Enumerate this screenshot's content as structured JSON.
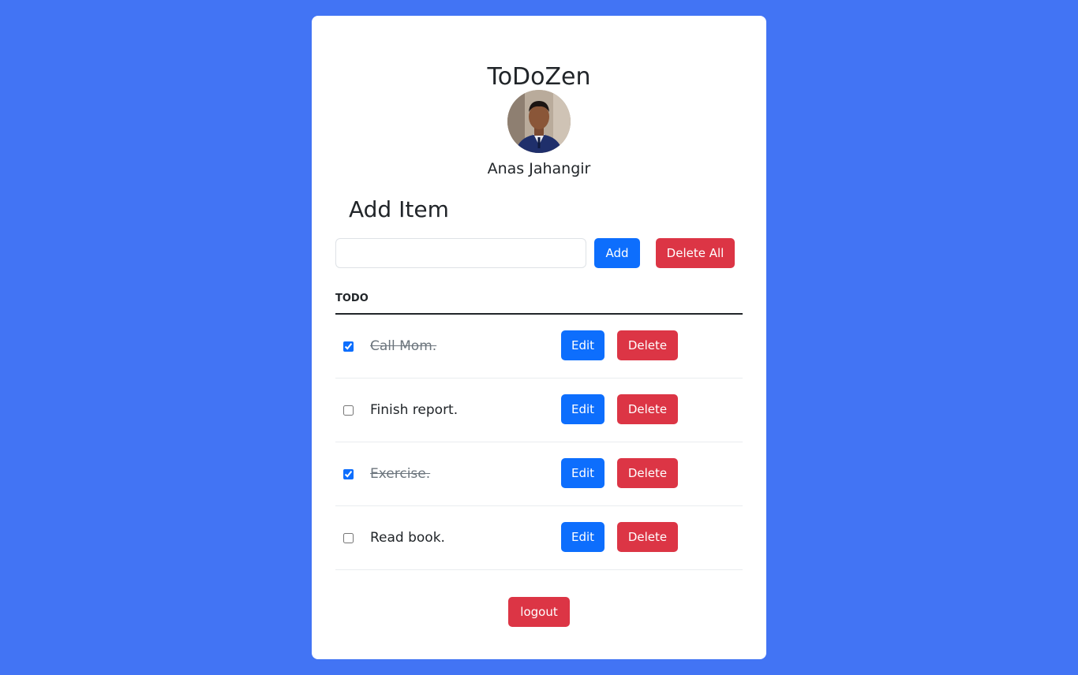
{
  "app": {
    "title": "ToDoZen",
    "user_name": "Anas Jahangir"
  },
  "add_section": {
    "heading": "Add Item",
    "input_value": "",
    "input_placeholder": "",
    "add_label": "Add",
    "delete_all_label": "Delete All"
  },
  "todo": {
    "header": "TODO",
    "items": [
      {
        "text": "Call Mom.",
        "done": true,
        "edit_label": "Edit",
        "delete_label": "Delete"
      },
      {
        "text": "Finish report.",
        "done": false,
        "edit_label": "Edit",
        "delete_label": "Delete"
      },
      {
        "text": "Exercise.",
        "done": true,
        "edit_label": "Edit",
        "delete_label": "Delete"
      },
      {
        "text": "Read book.",
        "done": false,
        "edit_label": "Edit",
        "delete_label": "Delete"
      }
    ]
  },
  "logout_label": "logout",
  "colors": {
    "background": "#4274f4",
    "primary": "#0d6efd",
    "danger": "#dc3545"
  }
}
